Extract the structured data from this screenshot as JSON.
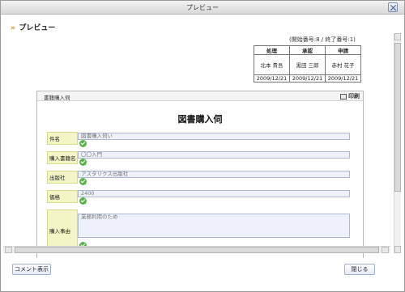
{
  "window": {
    "title": "プレビュー"
  },
  "header": {
    "label": "プレビュー"
  },
  "number_note": "(開始番号:8 / 終了番号:1)",
  "approval": {
    "columns": [
      "処理",
      "承認",
      "申請"
    ],
    "names": [
      "北本 貴吾",
      "黒田 三郎",
      "赤村 花子"
    ],
    "dates": [
      "2009/12/21",
      "2009/12/21",
      "2009/12/21"
    ]
  },
  "form": {
    "panel_title": "書籍購入伺",
    "print_label": "印刷",
    "title": "図書購入伺",
    "rows": [
      {
        "label": "件名",
        "value": "図書購入伺い"
      },
      {
        "label": "購入書籍名",
        "value": "〇〇入門"
      },
      {
        "label": "出版社",
        "value": "アスタリクス出版社"
      },
      {
        "label": "価格",
        "value": "2400"
      },
      {
        "label": "購入事由",
        "value": "業務利用のため"
      }
    ]
  },
  "footer": {
    "comment_button": "コメント表示",
    "close_button": "閉じる"
  }
}
